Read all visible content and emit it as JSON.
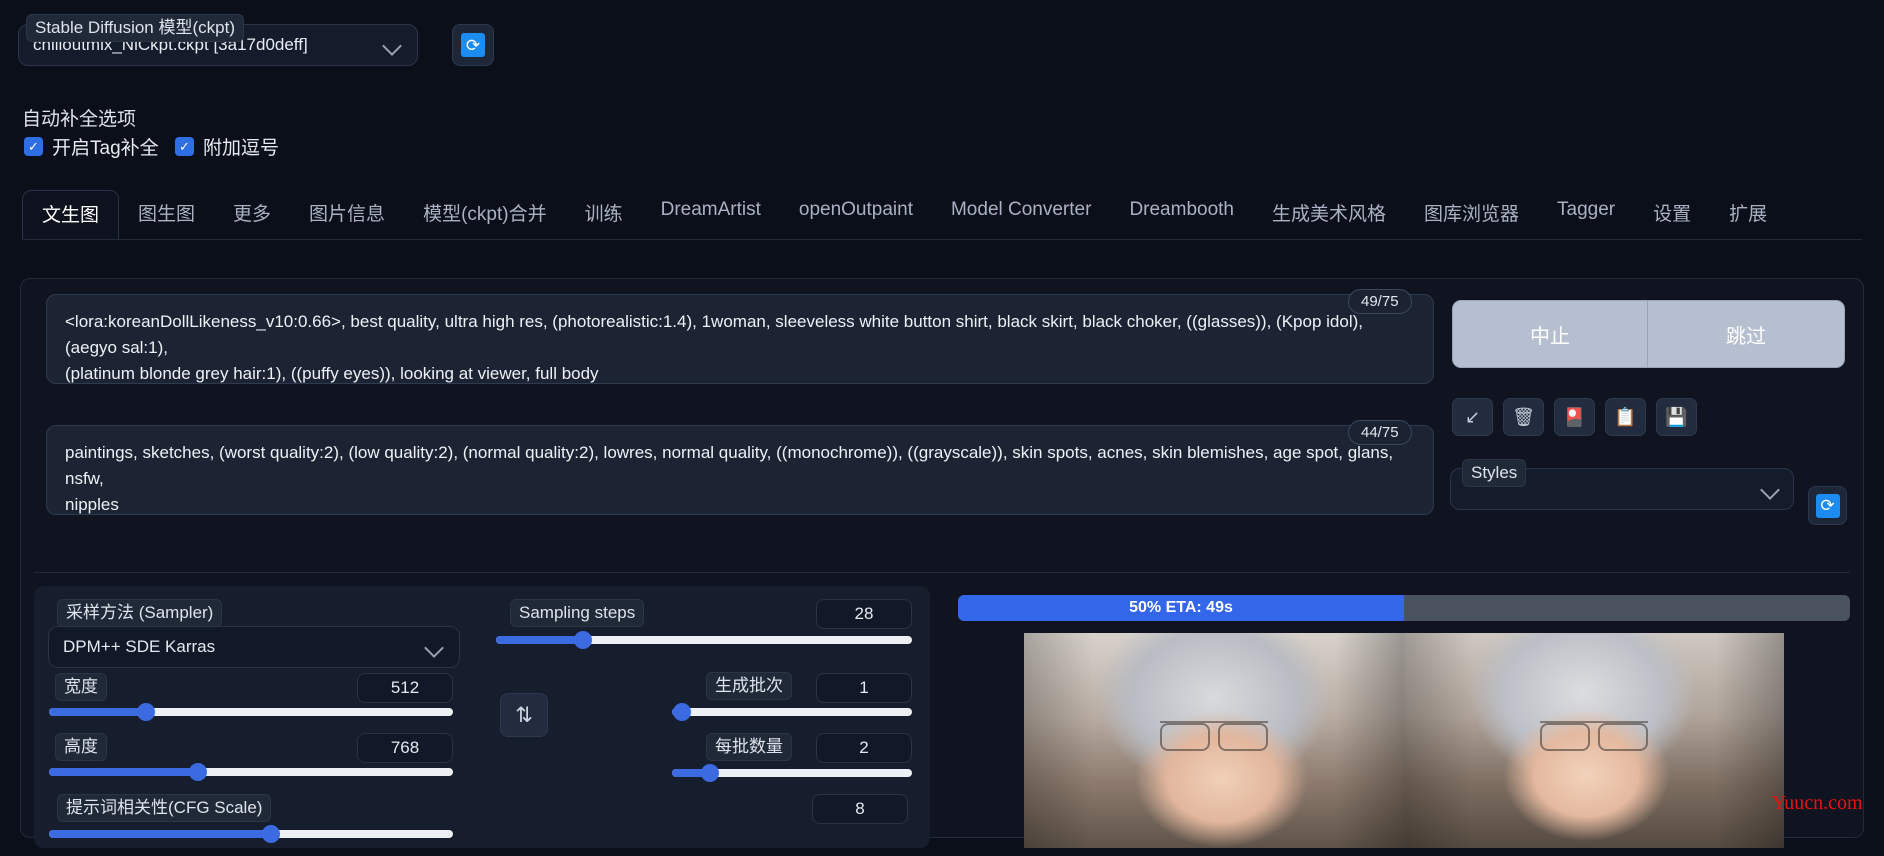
{
  "model": {
    "label": "Stable Diffusion 模型(ckpt)",
    "value": "chilloutmix_NiCkpt.ckpt [3a17d0deff]",
    "refresh_icon": "refresh-icon"
  },
  "autocomplete": {
    "title": "自动补全选项",
    "options": [
      {
        "label": "开启Tag补全",
        "checked": true
      },
      {
        "label": "附加逗号",
        "checked": true
      }
    ]
  },
  "tabs": [
    {
      "label": "文生图",
      "active": true
    },
    {
      "label": "图生图",
      "active": false
    },
    {
      "label": "更多",
      "active": false
    },
    {
      "label": "图片信息",
      "active": false
    },
    {
      "label": "模型(ckpt)合并",
      "active": false
    },
    {
      "label": "训练",
      "active": false
    },
    {
      "label": "DreamArtist",
      "active": false
    },
    {
      "label": "openOutpaint",
      "active": false
    },
    {
      "label": "Model Converter",
      "active": false
    },
    {
      "label": "Dreambooth",
      "active": false
    },
    {
      "label": "生成美术风格",
      "active": false
    },
    {
      "label": "图库浏览器",
      "active": false
    },
    {
      "label": "Tagger",
      "active": false
    },
    {
      "label": "设置",
      "active": false
    },
    {
      "label": "扩展",
      "active": false
    }
  ],
  "prompt": {
    "text": "<lora:koreanDollLikeness_v10:0.66>, best quality, ultra high res, (photorealistic:1.4), 1woman, sleeveless white button shirt, black skirt, black choker, ((glasses)), (Kpop idol), (aegyo sal:1), (platinum blonde grey hair:1), ((puffy eyes)), looking at viewer, full body",
    "line1": "<lora:koreanDollLikeness_v10:0.66>, best quality, ultra high res, (photorealistic:1.4), 1woman, sleeveless white button shirt, black skirt, black choker, ((glasses)), (Kpop idol), (aegyo sal:1),",
    "line2": "(platinum blonde grey hair:1), ((puffy eyes)), looking at viewer, full body",
    "token_count": "49/75"
  },
  "negative_prompt": {
    "text": "paintings, sketches, (worst quality:2), (low quality:2), (normal quality:2), lowres, normal quality, ((monochrome)), ((grayscale)), skin spots, acnes, skin blemishes, age spot, glans, nsfw, nipples",
    "line1": "paintings, sketches, (worst quality:2), (low quality:2), (normal quality:2), lowres, normal quality, ((monochrome)), ((grayscale)), skin spots, acnes, skin blemishes, age spot, glans, nsfw,",
    "line2": "nipples",
    "token_count": "44/75"
  },
  "actions": {
    "interrupt": "中止",
    "skip": "跳过",
    "icons": [
      {
        "name": "arrow-down-left-icon",
        "glyph": "↙"
      },
      {
        "name": "trash-icon",
        "glyph": "🗑"
      },
      {
        "name": "art-card-icon",
        "glyph": "🎴"
      },
      {
        "name": "clipboard-icon",
        "glyph": "📋"
      },
      {
        "name": "save-floppy-icon",
        "glyph": "💾"
      }
    ]
  },
  "styles": {
    "label": "Styles",
    "value": "",
    "refresh_icon": "refresh-icon"
  },
  "settings": {
    "sampler": {
      "label": "采样方法 (Sampler)",
      "value": "DPM++ SDE Karras"
    },
    "sampling_steps": {
      "label": "Sampling steps",
      "value": "28",
      "fill_percent": 21
    },
    "width": {
      "label": "宽度",
      "value": "512",
      "fill_percent": 24
    },
    "height": {
      "label": "高度",
      "value": "768",
      "fill_percent": 37
    },
    "cfg_scale": {
      "label": "提示词相关性(CFG Scale)",
      "value": "8",
      "fill_percent": 55
    },
    "batch_count": {
      "label": "生成批次",
      "value": "1",
      "fill_percent": 2
    },
    "batch_size": {
      "label": "每批数量",
      "value": "2",
      "fill_percent": 12
    },
    "swap_icon": "swap-arrows-icon"
  },
  "progress": {
    "text": "50% ETA: 49s",
    "percent": 50
  },
  "watermark": "Yuucn.com",
  "colors": {
    "accent": "#3366e8",
    "slider": "#3b6ae1",
    "checkbox": "#2f6fe4",
    "background": "#0b0f19",
    "panel": "#0f1420",
    "prompt_bg": "#1c2433",
    "button": "#b6bfd0",
    "watermark": "#e8130f",
    "refresh_icon": "#1d8cf0"
  }
}
